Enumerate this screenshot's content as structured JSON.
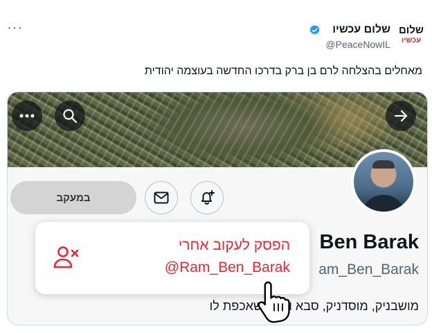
{
  "tweet": {
    "more_icon": "more-horizontal-icon",
    "logo_line1": "שלום",
    "logo_line2": "עכשיו",
    "display_name": "שלום עכשיו",
    "verified_icon": "verified-badge-icon",
    "handle": "@PeaceNowIL",
    "text": "מאחלים בהצלחה לרם בן ברק בדרכו החדשה בעוצמה יהודית"
  },
  "profile_card": {
    "banner_buttons": {
      "more_icon": "more-horizontal-icon",
      "search_icon": "search-icon",
      "forward_icon": "arrow-right-icon"
    },
    "follow_button_label": "במעקב",
    "message_icon": "envelope-icon",
    "notify_icon": "bell-plus-icon",
    "name": "Ben Barak",
    "handle": "am_Ben_Barak",
    "bio": "מושבניק, מוסדניק, סבא ואחד שאכפת לו"
  },
  "popup": {
    "icon": "unfollow-user-icon",
    "line1": "הפסק לעקוב אחרי",
    "line2": "@Ram_Ben_Barak"
  },
  "cursor_icon": "hand-pointer-icon",
  "colors": {
    "danger": "#f4212e",
    "verified": "#1d9bf0",
    "muted": "#536471",
    "logo_accent": "#e2261c"
  }
}
